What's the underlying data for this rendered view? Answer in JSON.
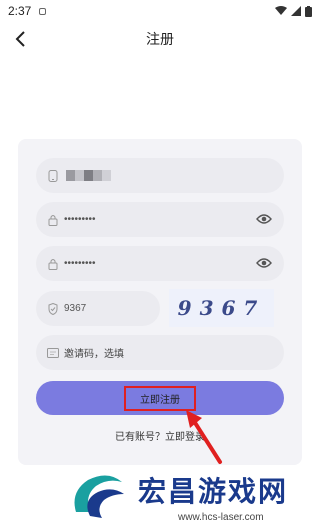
{
  "status_bar": {
    "time": "2:37"
  },
  "header": {
    "title": "注册"
  },
  "form": {
    "password": {
      "value": "•••••••••"
    },
    "confirm_password": {
      "value": "•••••••••"
    },
    "captcha": {
      "value": "9367"
    },
    "captcha_image": {
      "digits": [
        "9",
        "3",
        "6",
        "7"
      ]
    },
    "invite": {
      "placeholder": "邀请码，选填"
    },
    "register_button": {
      "label": "立即注册"
    },
    "login_link": {
      "label": "已有账号？立即登录"
    }
  },
  "watermark": {
    "title": "宏昌游戏网",
    "url": "www.hcs-laser.com"
  },
  "colors": {
    "accent": "#7b7be0",
    "highlight_border": "#e02020",
    "field_bg": "#ebebf0",
    "card_bg": "#f3f3f7"
  }
}
